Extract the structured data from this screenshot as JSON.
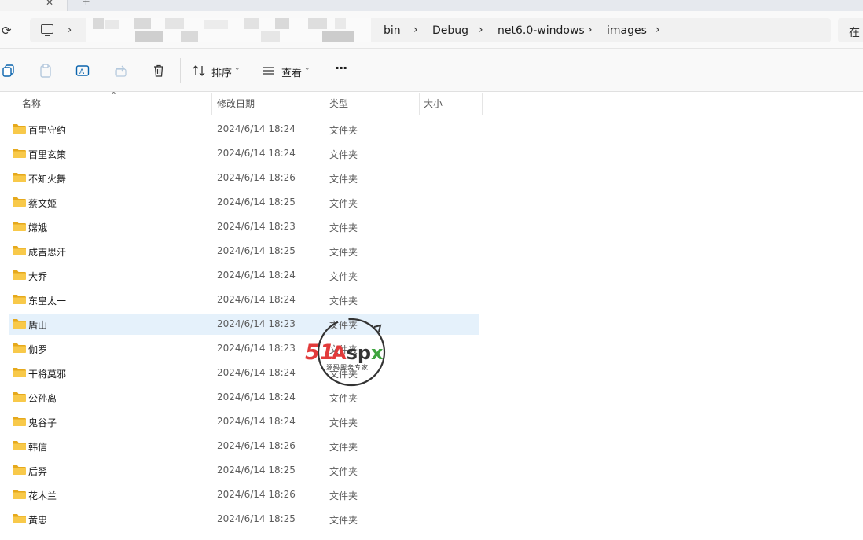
{
  "window": {
    "tab_close": "✕",
    "tab_new": "+"
  },
  "address": {
    "segments": [
      "bin",
      "Debug",
      "net6.0-windows",
      "images"
    ],
    "separator": "›",
    "search_text": "在"
  },
  "toolbar": {
    "sort_label": "排序",
    "view_label": "查看",
    "more_label": "···"
  },
  "columns": {
    "name": "名称",
    "date": "修改日期",
    "type": "类型",
    "size": "大小"
  },
  "files": [
    {
      "name": "百里守约",
      "date": "2024/6/14 18:24",
      "type": "文件夹"
    },
    {
      "name": "百里玄策",
      "date": "2024/6/14 18:24",
      "type": "文件夹"
    },
    {
      "name": "不知火舞",
      "date": "2024/6/14 18:26",
      "type": "文件夹"
    },
    {
      "name": "蔡文姬",
      "date": "2024/6/14 18:25",
      "type": "文件夹"
    },
    {
      "name": "嫦娥",
      "date": "2024/6/14 18:23",
      "type": "文件夹"
    },
    {
      "name": "成吉思汗",
      "date": "2024/6/14 18:25",
      "type": "文件夹"
    },
    {
      "name": "大乔",
      "date": "2024/6/14 18:24",
      "type": "文件夹"
    },
    {
      "name": "东皇太一",
      "date": "2024/6/14 18:24",
      "type": "文件夹"
    },
    {
      "name": "盾山",
      "date": "2024/6/14 18:23",
      "type": "文件夹",
      "selected": true
    },
    {
      "name": "伽罗",
      "date": "2024/6/14 18:23",
      "type": "文件夹"
    },
    {
      "name": "干将莫邪",
      "date": "2024/6/14 18:24",
      "type": "文件夹"
    },
    {
      "name": "公孙离",
      "date": "2024/6/14 18:24",
      "type": "文件夹"
    },
    {
      "name": "鬼谷子",
      "date": "2024/6/14 18:24",
      "type": "文件夹"
    },
    {
      "name": "韩信",
      "date": "2024/6/14 18:26",
      "type": "文件夹"
    },
    {
      "name": "后羿",
      "date": "2024/6/14 18:25",
      "type": "文件夹"
    },
    {
      "name": "花木兰",
      "date": "2024/6/14 18:26",
      "type": "文件夹"
    },
    {
      "name": "黄忠",
      "date": "2024/6/14 18:25",
      "type": "文件夹"
    }
  ],
  "watermark": {
    "brand_a": "51",
    "brand_b": "Aspx",
    "slogan": "源码服务专家"
  },
  "colors": {
    "selection": "#e5f1fb",
    "folder": "#f8c94a",
    "folder_dark": "#e6a91c",
    "watermark_red": "#e23b3b",
    "watermark_green": "#3fa43f"
  }
}
